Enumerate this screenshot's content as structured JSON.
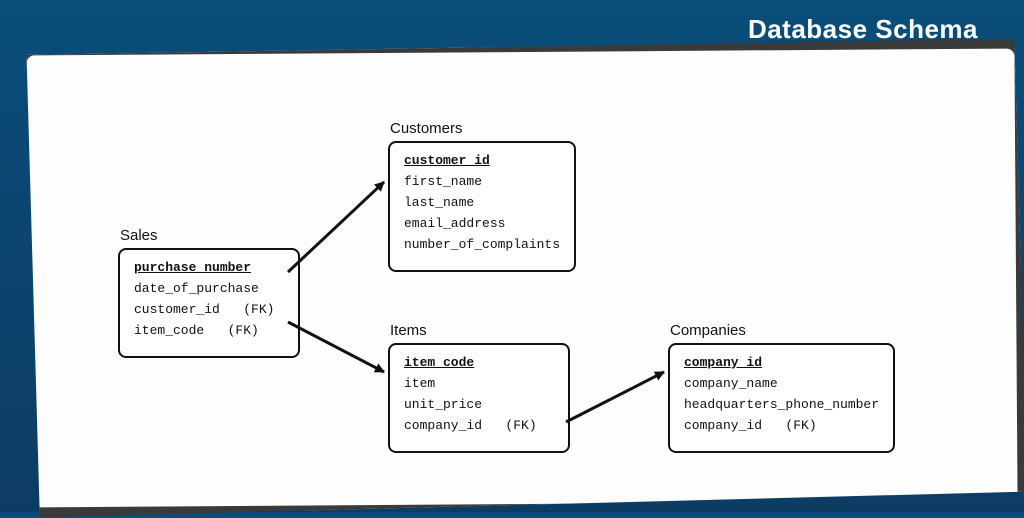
{
  "title": "Database Schema",
  "entities": {
    "sales": {
      "name": "Sales",
      "pk": "purchase number",
      "fields": [
        "date_of_purchase",
        "customer_id   (FK)",
        "item_code   (FK)"
      ]
    },
    "customers": {
      "name": "Customers",
      "pk": "customer_id",
      "fields": [
        "first_name",
        "last_name",
        "email_address",
        "number_of_complaints"
      ]
    },
    "items": {
      "name": "Items",
      "pk": "item code",
      "fields": [
        "item",
        "unit_price",
        "company_id   (FK)"
      ]
    },
    "companies": {
      "name": "Companies",
      "pk": "company_id",
      "fields": [
        "company_name",
        "headquarters_phone_number",
        "company_id   (FK)"
      ]
    }
  },
  "relations": [
    {
      "from": "sales",
      "to": "customers"
    },
    {
      "from": "sales",
      "to": "items"
    },
    {
      "from": "items",
      "to": "companies"
    }
  ]
}
